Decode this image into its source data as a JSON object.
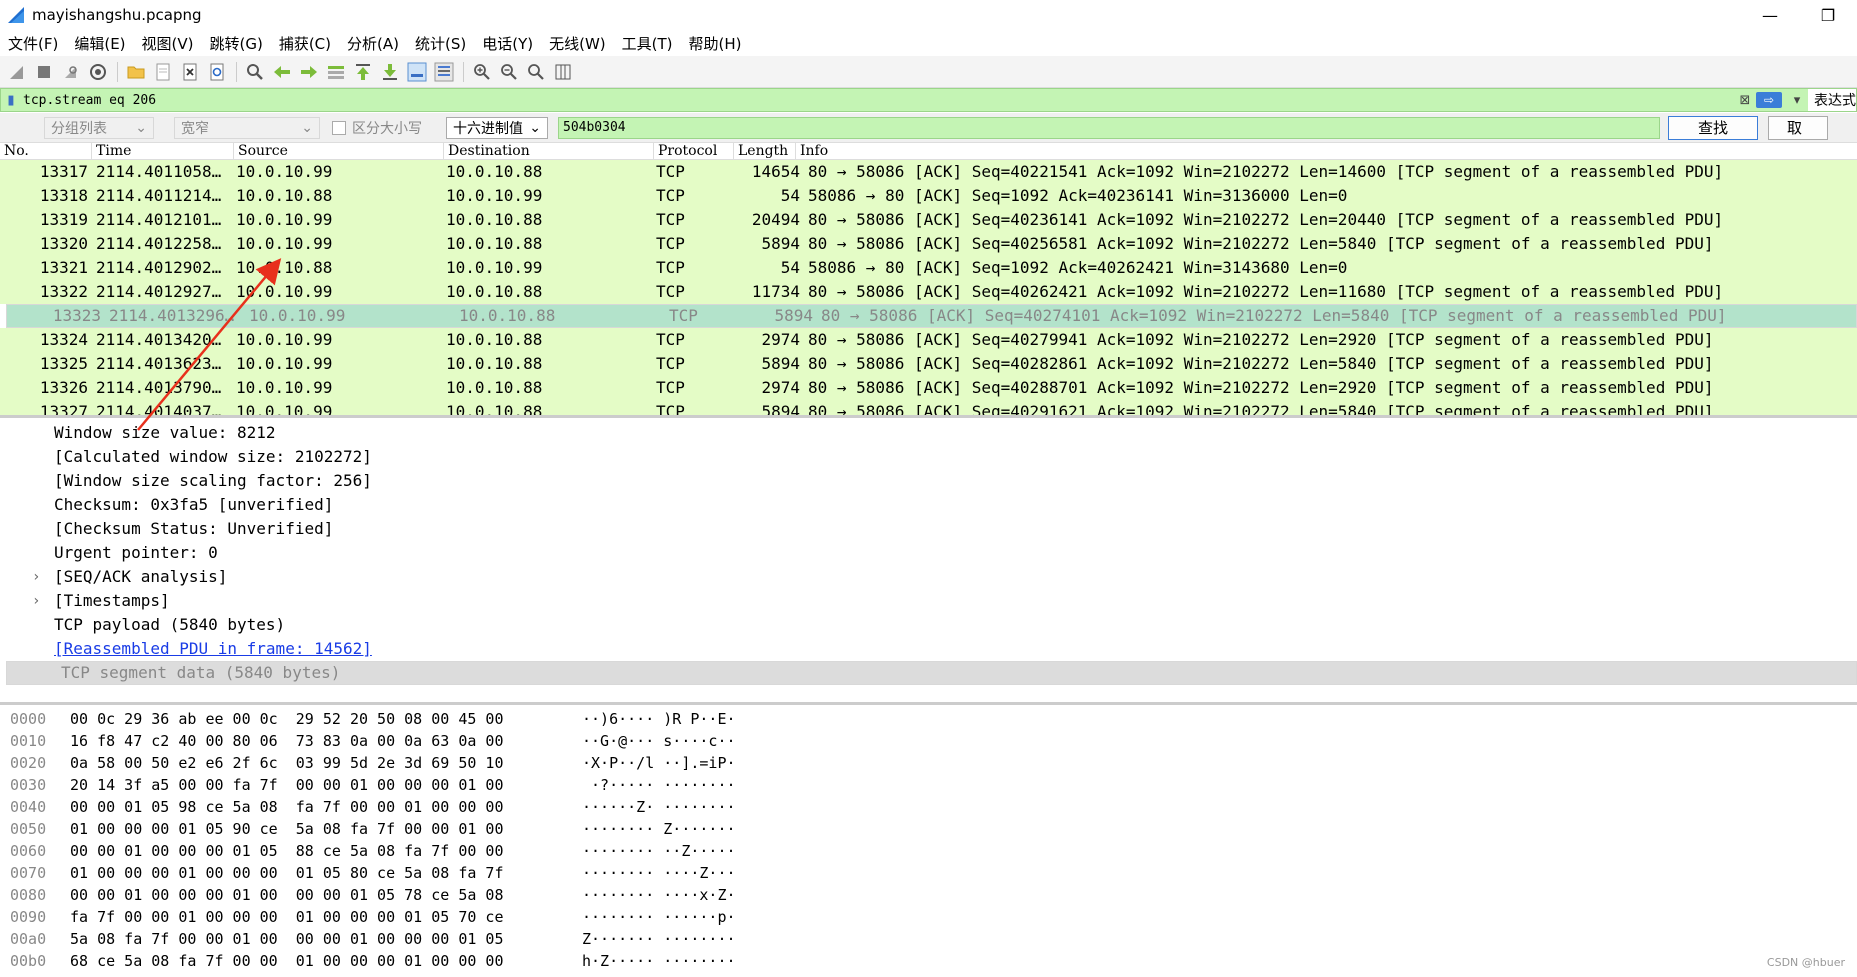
{
  "window": {
    "title": "mayishangshu.pcapng",
    "minimize": "—",
    "restore": "❐"
  },
  "menu": [
    "文件(F)",
    "编辑(E)",
    "视图(V)",
    "跳转(G)",
    "捕获(C)",
    "分析(A)",
    "统计(S)",
    "电话(Y)",
    "无线(W)",
    "工具(T)",
    "帮助(H)"
  ],
  "toolbar": {
    "icons": [
      "shark-fin-icon",
      "stop-icon",
      "restart-icon",
      "capture-options-icon",
      "open-folder-icon",
      "save-icon",
      "close-file-icon",
      "reload-icon",
      "find-packet-icon",
      "go-back-icon",
      "go-forward-icon",
      "go-to-packet-icon",
      "go-first-icon",
      "go-last-icon",
      "auto-scroll-icon",
      "colorize-icon",
      "zoom-in-icon",
      "zoom-out-icon",
      "zoom-normal-icon",
      "resize-columns-icon"
    ]
  },
  "filter": {
    "value": "tcp.stream eq 206",
    "expression_label": "表达式"
  },
  "search": {
    "scope": "分组列表",
    "charset": "宽窄",
    "case_label": "区分大小写",
    "type": "十六进制值",
    "value": "504b0304",
    "find_label": "查找",
    "cancel_label": "取"
  },
  "packet_list": {
    "columns": [
      "No.",
      "Time",
      "Source",
      "Destination",
      "Protocol",
      "Length",
      "Info"
    ],
    "rows": [
      {
        "no": "13317",
        "time": "2114.4011058…",
        "src": "10.0.10.99",
        "dst": "10.0.10.88",
        "proto": "TCP",
        "len": "14654",
        "info": "80 → 58086 [ACK] Seq=40221541 Ack=1092 Win=2102272 Len=14600 [TCP segment of a reassembled PDU]"
      },
      {
        "no": "13318",
        "time": "2114.4011214…",
        "src": "10.0.10.88",
        "dst": "10.0.10.99",
        "proto": "TCP",
        "len": "54",
        "info": "58086 → 80 [ACK] Seq=1092 Ack=40236141 Win=3136000 Len=0"
      },
      {
        "no": "13319",
        "time": "2114.4012101…",
        "src": "10.0.10.99",
        "dst": "10.0.10.88",
        "proto": "TCP",
        "len": "20494",
        "info": "80 → 58086 [ACK] Seq=40236141 Ack=1092 Win=2102272 Len=20440 [TCP segment of a reassembled PDU]"
      },
      {
        "no": "13320",
        "time": "2114.4012258…",
        "src": "10.0.10.99",
        "dst": "10.0.10.88",
        "proto": "TCP",
        "len": "5894",
        "info": "80 → 58086 [ACK] Seq=40256581 Ack=1092 Win=2102272 Len=5840 [TCP segment of a reassembled PDU]"
      },
      {
        "no": "13321",
        "time": "2114.4012902…",
        "src": "10.0.10.88",
        "dst": "10.0.10.99",
        "proto": "TCP",
        "len": "54",
        "info": "58086 → 80 [ACK] Seq=1092 Ack=40262421 Win=3143680 Len=0"
      },
      {
        "no": "13322",
        "time": "2114.4012927…",
        "src": "10.0.10.99",
        "dst": "10.0.10.88",
        "proto": "TCP",
        "len": "11734",
        "info": "80 → 58086 [ACK] Seq=40262421 Ack=1092 Win=2102272 Len=11680 [TCP segment of a reassembled PDU]"
      },
      {
        "no": "13323",
        "time": "2114.4013296…",
        "src": "10.0.10.99",
        "dst": "10.0.10.88",
        "proto": "TCP",
        "len": "5894",
        "info": "80 → 58086 [ACK] Seq=40274101 Ack=1092 Win=2102272 Len=5840 [TCP segment of a reassembled PDU]",
        "selected": true
      },
      {
        "no": "13324",
        "time": "2114.4013420…",
        "src": "10.0.10.99",
        "dst": "10.0.10.88",
        "proto": "TCP",
        "len": "2974",
        "info": "80 → 58086 [ACK] Seq=40279941 Ack=1092 Win=2102272 Len=2920 [TCP segment of a reassembled PDU]"
      },
      {
        "no": "13325",
        "time": "2114.4013623…",
        "src": "10.0.10.99",
        "dst": "10.0.10.88",
        "proto": "TCP",
        "len": "5894",
        "info": "80 → 58086 [ACK] Seq=40282861 Ack=1092 Win=2102272 Len=5840 [TCP segment of a reassembled PDU]"
      },
      {
        "no": "13326",
        "time": "2114.4013790…",
        "src": "10.0.10.99",
        "dst": "10.0.10.88",
        "proto": "TCP",
        "len": "2974",
        "info": "80 → 58086 [ACK] Seq=40288701 Ack=1092 Win=2102272 Len=2920 [TCP segment of a reassembled PDU]"
      },
      {
        "no": "13327",
        "time": "2114.4014037…",
        "src": "10.0.10.99",
        "dst": "10.0.10.88",
        "proto": "TCP",
        "len": "5894",
        "info": "80 → 58086 [ACK] Seq=40291621 Ack=1092 Win=2102272 Len=5840 [TCP segment of a reassembled PDU]"
      }
    ]
  },
  "details": [
    {
      "text": "Window size value: 8212"
    },
    {
      "text": "[Calculated window size: 2102272]"
    },
    {
      "text": "[Window size scaling factor: 256]"
    },
    {
      "text": "Checksum: 0x3fa5 [unverified]"
    },
    {
      "text": "[Checksum Status: Unverified]"
    },
    {
      "text": "Urgent pointer: 0"
    },
    {
      "text": "[SEQ/ACK analysis]",
      "expander": "›"
    },
    {
      "text": "[Timestamps]",
      "expander": "›"
    },
    {
      "text": "TCP payload (5840 bytes)"
    },
    {
      "text": "[Reassembled PDU in frame: 14562]",
      "link": true
    },
    {
      "text": "TCP segment data (5840 bytes)",
      "selected": true
    }
  ],
  "hex": [
    {
      "off": "0000",
      "hex": "00 0c 29 36 ab ee 00 0c  29 52 20 50 08 00 45 00",
      "ascii": "··)6···· )R P··E·"
    },
    {
      "off": "0010",
      "hex": "16 f8 47 c2 40 00 80 06  73 83 0a 00 0a 63 0a 00",
      "ascii": "··G·@··· s····c··"
    },
    {
      "off": "0020",
      "hex": "0a 58 00 50 e2 e6 2f 6c  03 99 5d 2e 3d 69 50 10",
      "ascii": "·X·P··/l ··].=iP·"
    },
    {
      "off": "0030",
      "hex": "20 14 3f a5 00 00 fa 7f  00 00 01 00 00 00 01 00",
      "ascii": " ·?····· ········"
    },
    {
      "off": "0040",
      "hex": "00 00 01 05 98 ce 5a 08  fa 7f 00 00 01 00 00 00",
      "ascii": "······Z· ········"
    },
    {
      "off": "0050",
      "hex": "01 00 00 00 01 05 90 ce  5a 08 fa 7f 00 00 01 00",
      "ascii": "········ Z·······"
    },
    {
      "off": "0060",
      "hex": "00 00 01 00 00 00 01 05  88 ce 5a 08 fa 7f 00 00",
      "ascii": "········ ··Z·····"
    },
    {
      "off": "0070",
      "hex": "01 00 00 00 01 00 00 00  01 05 80 ce 5a 08 fa 7f",
      "ascii": "········ ····Z···"
    },
    {
      "off": "0080",
      "hex": "00 00 01 00 00 00 01 00  00 00 01 05 78 ce 5a 08",
      "ascii": "········ ····x·Z·"
    },
    {
      "off": "0090",
      "hex": "fa 7f 00 00 01 00 00 00  01 00 00 00 01 05 70 ce",
      "ascii": "········ ······p·"
    },
    {
      "off": "00a0",
      "hex": "5a 08 fa 7f 00 00 01 00  00 00 01 00 00 00 01 05",
      "ascii": "Z······· ········"
    },
    {
      "off": "00b0",
      "hex": "68 ce 5a 08 fa 7f 00 00  01 00 00 00 01 00 00 00",
      "ascii": "h·Z····· ········"
    }
  ],
  "colors": {
    "row_bg": "#e4fcc6",
    "row_selected": "#b3e3cb",
    "filter_bg": "#c4f4b4",
    "arrow": "#e8301c",
    "link": "#1a3ce6"
  },
  "watermark": "CSDN @hbuer"
}
